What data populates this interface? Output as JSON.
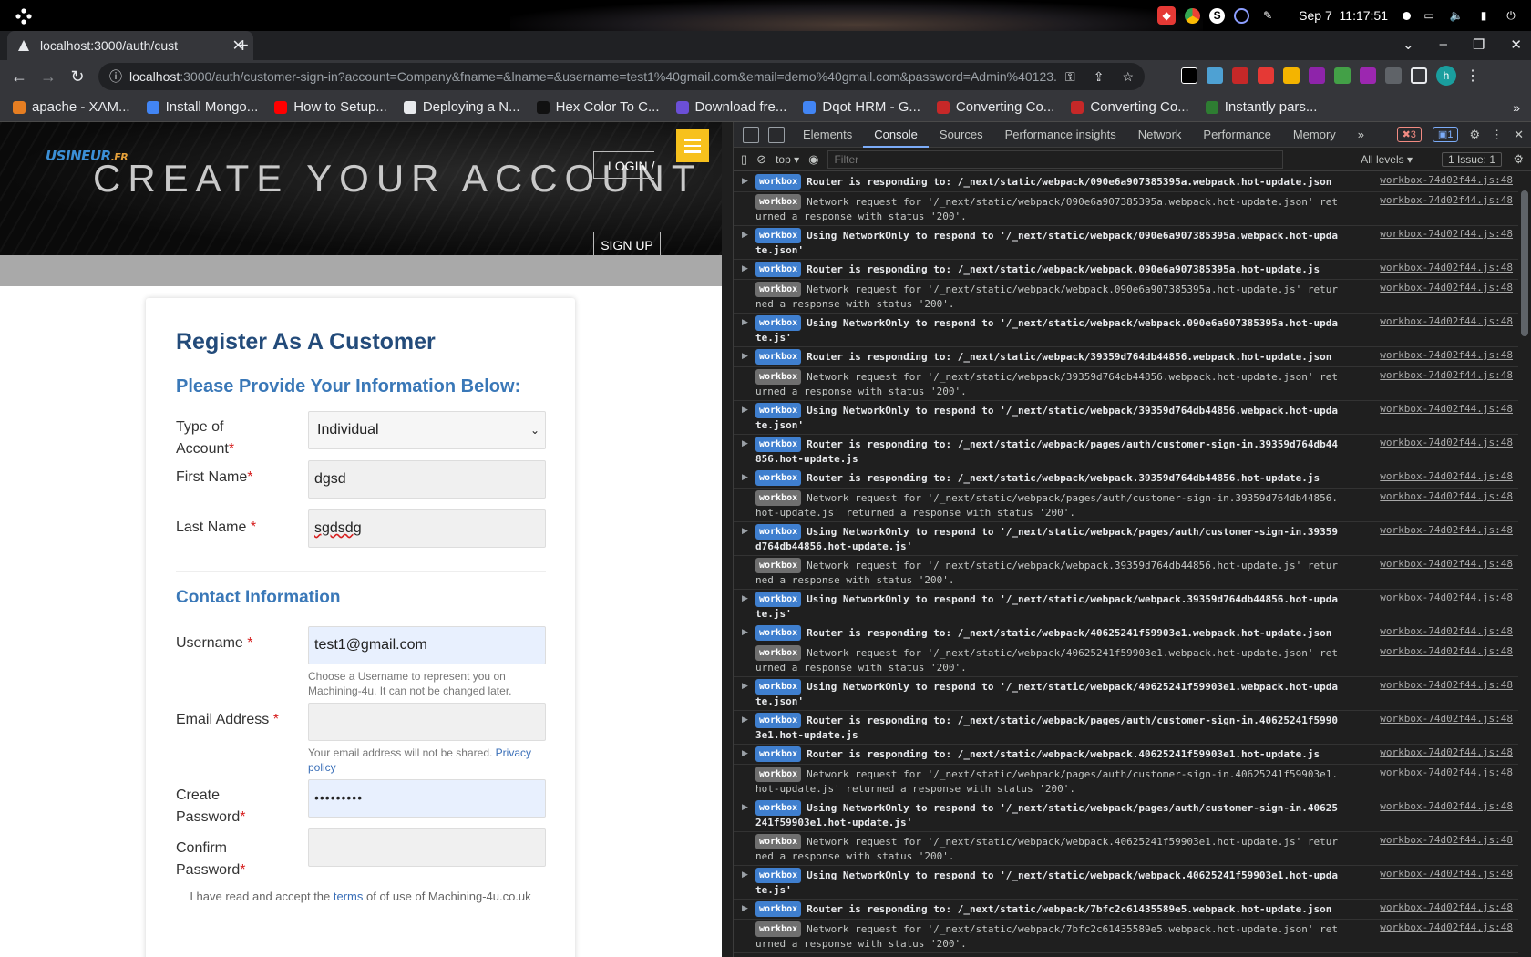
{
  "os_bar": {
    "date": "Sep 7",
    "time": "11:17:51"
  },
  "tab": {
    "title": "localhost:3000/auth/cust"
  },
  "omnibox": {
    "host": "localhost",
    "rest": ":3000/auth/customer-sign-in?account=Company&fname=&lname=&username=test1%40gmail.com&email=demo%40gmail.com&password=Admin%40123..."
  },
  "bookmarks": [
    {
      "label": "apache - XAM...",
      "color": "#e67e22"
    },
    {
      "label": "Install Mongo...",
      "color": "#4285f4"
    },
    {
      "label": "How to Setup...",
      "color": "#ff0000"
    },
    {
      "label": "Deploying a N...",
      "color": "#e8eaed"
    },
    {
      "label": "Hex Color To C...",
      "color": "#111111"
    },
    {
      "label": "Download fre...",
      "color": "#6b4fd6"
    },
    {
      "label": "Dqot HRM - G...",
      "color": "#4285f4"
    },
    {
      "label": "Converting Co...",
      "color": "#c62828"
    },
    {
      "label": "Converting Co...",
      "color": "#c62828"
    },
    {
      "label": "Instantly pars...",
      "color": "#2e7d32"
    }
  ],
  "site": {
    "logo_main": "USINEUR",
    "logo_suffix": ".FR",
    "hero_title": "CREATE YOUR ACCOUNT",
    "login_label": "LOGIN /",
    "signup_label": "SIGN UP"
  },
  "form": {
    "title": "Register As A Customer",
    "section_info": "Please Provide Your Information Below:",
    "type_label_1": "Type of",
    "type_label_2": "Account",
    "type_value": "Individual",
    "first_name_label": "First Name",
    "first_name_value": "dgsd",
    "last_name_label": "Last Name ",
    "last_name_value": "sgdsdg",
    "section_contact": "Contact Information",
    "username_label": "Username ",
    "username_value": "test1@gmail.com",
    "username_help": "Choose a Username to represent you on Machining-4u. It can not be changed later.",
    "email_label": "Email Address ",
    "email_value": "",
    "email_help": "Your email address will not be shared. ",
    "privacy_link": "Privacy policy",
    "password_label_1": "Create",
    "password_label_2": "Password",
    "password_value": "•••••••••",
    "confirm_label_1": "Confirm",
    "confirm_label_2": "Password",
    "confirm_value": "",
    "req": "*",
    "terms_prefix": "I have read and accept the ",
    "terms_link": "terms",
    "terms_suffix": " of of use of Machining-4u.co.uk"
  },
  "devtools": {
    "tabs": [
      "Elements",
      "Console",
      "Sources",
      "Performance insights",
      "Network",
      "Performance",
      "Memory"
    ],
    "more": "»",
    "errors": "3",
    "messages": "1",
    "context": "top",
    "filter_placeholder": "Filter",
    "levels": "All levels",
    "issues": "1 Issue: 1",
    "logs": [
      {
        "tag": "workbox",
        "kind": "strong",
        "text": "Router is responding to: /_next/static/webpack/090e6a907385395a.webpack.hot-update.json",
        "src": "workbox-74d02f44.js:48"
      },
      {
        "tag": "workbox",
        "kind": "weak",
        "text": "Network request for '/_next/static/webpack/090e6a907385395a.webpack.hot-update.json' returned a response with status '200'.",
        "src": "workbox-74d02f44.js:48"
      },
      {
        "tag": "workbox",
        "kind": "strong",
        "text": "Using NetworkOnly to respond to '/_next/static/webpack/090e6a907385395a.webpack.hot-update.json'",
        "src": "workbox-74d02f44.js:48"
      },
      {
        "tag": "workbox",
        "kind": "strong",
        "text": "Router is responding to: /_next/static/webpack/webpack.090e6a907385395a.hot-update.js",
        "src": "workbox-74d02f44.js:48"
      },
      {
        "tag": "workbox",
        "kind": "weak",
        "text": "Network request for '/_next/static/webpack/webpack.090e6a907385395a.hot-update.js' returned a response with status '200'.",
        "src": "workbox-74d02f44.js:48"
      },
      {
        "tag": "workbox",
        "kind": "strong",
        "text": "Using NetworkOnly to respond to '/_next/static/webpack/webpack.090e6a907385395a.hot-update.js'",
        "src": "workbox-74d02f44.js:48"
      },
      {
        "tag": "workbox",
        "kind": "strong",
        "text": "Router is responding to: /_next/static/webpack/39359d764db44856.webpack.hot-update.json",
        "src": "workbox-74d02f44.js:48"
      },
      {
        "tag": "workbox",
        "kind": "weak",
        "text": "Network request for '/_next/static/webpack/39359d764db44856.webpack.hot-update.json' returned a response with status '200'.",
        "src": "workbox-74d02f44.js:48"
      },
      {
        "tag": "workbox",
        "kind": "strong",
        "text": "Using NetworkOnly to respond to '/_next/static/webpack/39359d764db44856.webpack.hot-update.json'",
        "src": "workbox-74d02f44.js:48"
      },
      {
        "tag": "workbox",
        "kind": "strong",
        "text": "Router is responding to: /_next/static/webpack/pages/auth/customer-sign-in.39359d764db44856.hot-update.js",
        "src": "workbox-74d02f44.js:48"
      },
      {
        "tag": "workbox",
        "kind": "strong",
        "text": "Router is responding to: /_next/static/webpack/webpack.39359d764db44856.hot-update.js",
        "src": "workbox-74d02f44.js:48"
      },
      {
        "tag": "workbox",
        "kind": "weak",
        "text": "Network request for '/_next/static/webpack/pages/auth/customer-sign-in.39359d764db44856.hot-update.js' returned a response with status '200'.",
        "src": "workbox-74d02f44.js:48"
      },
      {
        "tag": "workbox",
        "kind": "strong",
        "text": "Using NetworkOnly to respond to '/_next/static/webpack/pages/auth/customer-sign-in.39359d764db44856.hot-update.js'",
        "src": "workbox-74d02f44.js:48"
      },
      {
        "tag": "workbox",
        "kind": "weak",
        "text": "Network request for '/_next/static/webpack/webpack.39359d764db44856.hot-update.js' returned a response with status '200'.",
        "src": "workbox-74d02f44.js:48"
      },
      {
        "tag": "workbox",
        "kind": "strong",
        "text": "Using NetworkOnly to respond to '/_next/static/webpack/webpack.39359d764db44856.hot-update.js'",
        "src": "workbox-74d02f44.js:48"
      },
      {
        "tag": "workbox",
        "kind": "strong",
        "text": "Router is responding to: /_next/static/webpack/40625241f59903e1.webpack.hot-update.json",
        "src": "workbox-74d02f44.js:48"
      },
      {
        "tag": "workbox",
        "kind": "weak",
        "text": "Network request for '/_next/static/webpack/40625241f59903e1.webpack.hot-update.json' returned a response with status '200'.",
        "src": "workbox-74d02f44.js:48"
      },
      {
        "tag": "workbox",
        "kind": "strong",
        "text": "Using NetworkOnly to respond to '/_next/static/webpack/40625241f59903e1.webpack.hot-update.json'",
        "src": "workbox-74d02f44.js:48"
      },
      {
        "tag": "workbox",
        "kind": "strong",
        "text": "Router is responding to: /_next/static/webpack/pages/auth/customer-sign-in.40625241f59903e1.hot-update.js",
        "src": "workbox-74d02f44.js:48"
      },
      {
        "tag": "workbox",
        "kind": "strong",
        "text": "Router is responding to: /_next/static/webpack/webpack.40625241f59903e1.hot-update.js",
        "src": "workbox-74d02f44.js:48"
      },
      {
        "tag": "workbox",
        "kind": "weak",
        "text": "Network request for '/_next/static/webpack/pages/auth/customer-sign-in.40625241f59903e1.hot-update.js' returned a response with status '200'.",
        "src": "workbox-74d02f44.js:48"
      },
      {
        "tag": "workbox",
        "kind": "strong",
        "text": "Using NetworkOnly to respond to '/_next/static/webpack/pages/auth/customer-sign-in.40625241f59903e1.hot-update.js'",
        "src": "workbox-74d02f44.js:48"
      },
      {
        "tag": "workbox",
        "kind": "weak",
        "text": "Network request for '/_next/static/webpack/webpack.40625241f59903e1.hot-update.js' returned a response with status '200'.",
        "src": "workbox-74d02f44.js:48"
      },
      {
        "tag": "workbox",
        "kind": "strong",
        "text": "Using NetworkOnly to respond to '/_next/static/webpack/webpack.40625241f59903e1.hot-update.js'",
        "src": "workbox-74d02f44.js:48"
      },
      {
        "tag": "workbox",
        "kind": "strong",
        "text": "Router is responding to: /_next/static/webpack/7bfc2c61435589e5.webpack.hot-update.json",
        "src": "workbox-74d02f44.js:48"
      },
      {
        "tag": "workbox",
        "kind": "weak",
        "text": "Network request for '/_next/static/webpack/7bfc2c61435589e5.webpack.hot-update.json' returned a response with status '200'.",
        "src": "workbox-74d02f44.js:48"
      }
    ]
  }
}
